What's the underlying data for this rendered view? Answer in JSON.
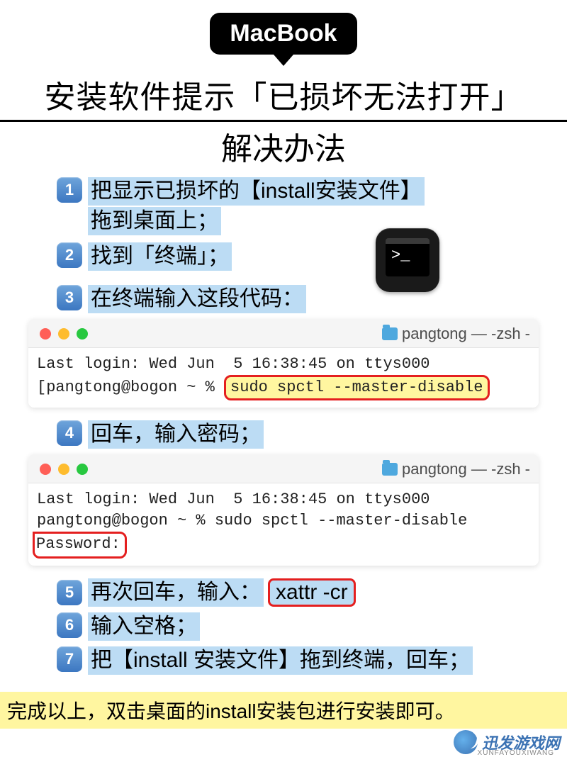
{
  "badge": "MacBook",
  "title_line1": "安装软件提示「已损坏无法打开」",
  "title_line2": "解决办法",
  "steps": {
    "s1a": "把显示已损坏的【install安装文件】",
    "s1b": "拖到桌面上；",
    "s2": "找到「终端」；",
    "s3": "在终端输入这段代码：",
    "s4": "回车，输入密码；",
    "s5_prefix": "再次回车，输入：",
    "s5_cmd": "xattr -cr",
    "s6": "输入空格；",
    "s7": "把【install 安装文件】拖到终端，回车；"
  },
  "terminal1": {
    "title": "pangtong — -zsh -",
    "line1": "Last login: Wed Jun  5 16:38:45 on ttys000",
    "prompt": "[pangtong@bogon ~ % ",
    "command": "sudo spctl --master-disable"
  },
  "terminal2": {
    "title": "pangtong — -zsh -",
    "line1": "Last login: Wed Jun  5 16:38:45 on ttys000",
    "line2": "pangtong@bogon ~ % sudo spctl --master-disable",
    "password_label": "Password:"
  },
  "footer": "完成以上，双击桌面的install安装包进行安装即可。",
  "watermark": {
    "name": "迅发游戏网",
    "sub": "XUNFAYOUXIWANG"
  }
}
